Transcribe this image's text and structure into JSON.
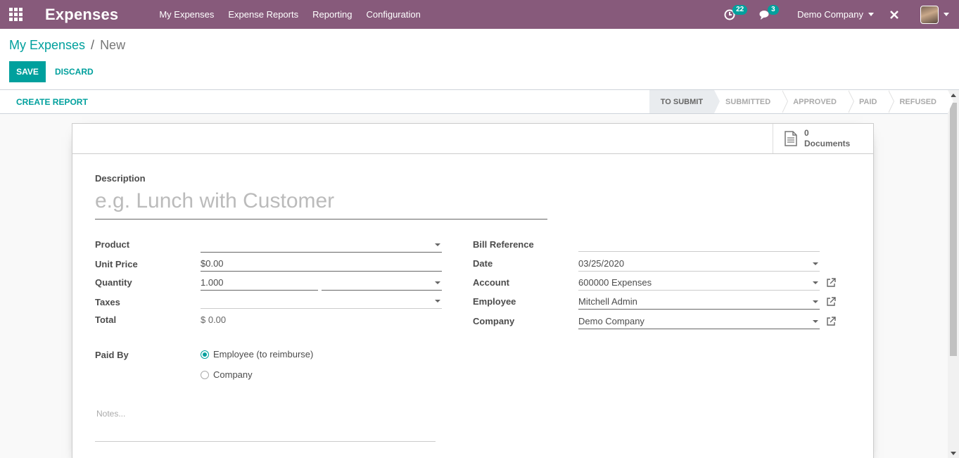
{
  "navbar": {
    "app_title": "Expenses",
    "menu": [
      "My Expenses",
      "Expense Reports",
      "Reporting",
      "Configuration"
    ],
    "activity_count": "22",
    "messages_count": "3",
    "company": "Demo Company"
  },
  "breadcrumb": {
    "parent": "My Expenses",
    "separator": "/",
    "current": "New"
  },
  "actions": {
    "save": "SAVE",
    "discard": "DISCARD",
    "create_report": "CREATE REPORT"
  },
  "stages": [
    "TO SUBMIT",
    "SUBMITTED",
    "APPROVED",
    "PAID",
    "REFUSED"
  ],
  "active_stage": "TO SUBMIT",
  "documents": {
    "count": "0",
    "label": "Documents"
  },
  "form": {
    "description_label": "Description",
    "description_placeholder": "e.g. Lunch with Customer",
    "product_label": "Product",
    "product_value": "",
    "unit_price_label": "Unit Price",
    "unit_price_value": "$0.00",
    "quantity_label": "Quantity",
    "quantity_value": "1.000",
    "uom_value": "",
    "taxes_label": "Taxes",
    "taxes_value": "",
    "total_label": "Total",
    "total_value": "$ 0.00",
    "bill_reference_label": "Bill Reference",
    "bill_reference_value": "",
    "date_label": "Date",
    "date_value": "03/25/2020",
    "account_label": "Account",
    "account_value": "600000 Expenses",
    "employee_label": "Employee",
    "employee_value": "Mitchell Admin",
    "company_label": "Company",
    "company_value": "Demo Company",
    "paid_by_label": "Paid By",
    "paid_by_options": [
      "Employee (to reimburse)",
      "Company"
    ],
    "paid_by_selected": "Employee (to reimburse)",
    "notes_placeholder": "Notes..."
  },
  "colors": {
    "brand": "#875a7b",
    "accent": "#00a09d"
  }
}
